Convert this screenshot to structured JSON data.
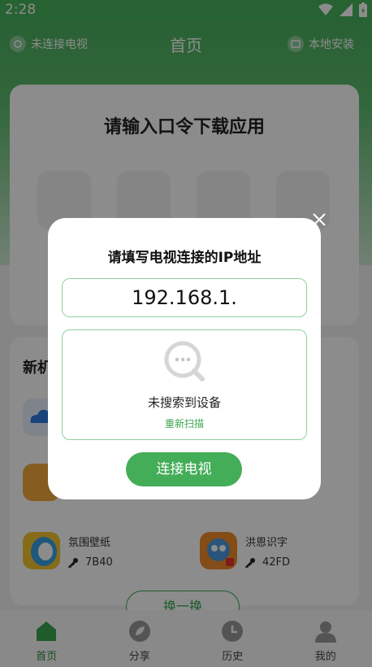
{
  "status_bar": {
    "time": "2:28"
  },
  "header": {
    "left_label": "未连接电视",
    "title": "首页",
    "right_label": "本地安装"
  },
  "main_card": {
    "title": "请输入口令下载应用"
  },
  "new_apps": {
    "title": "新机",
    "apps": [
      {
        "name": "氛围壁纸",
        "code": "7B40"
      },
      {
        "name": "洪恩识字",
        "code": "42FD"
      }
    ],
    "change_label": "换一换"
  },
  "bottom_nav": [
    {
      "label": "首页",
      "icon": "home-icon"
    },
    {
      "label": "分享",
      "icon": "share-icon"
    },
    {
      "label": "历史",
      "icon": "history-icon"
    },
    {
      "label": "我的",
      "icon": "profile-icon"
    }
  ],
  "dialog": {
    "title": "请填写电视连接的IP地址",
    "ip_value": "192.168.1.",
    "empty_text": "未搜索到设备",
    "rescan_label": "重新扫描",
    "connect_label": "连接电视"
  },
  "colors": {
    "brand_green": "#43ad57",
    "border_green": "#8fd19c"
  }
}
